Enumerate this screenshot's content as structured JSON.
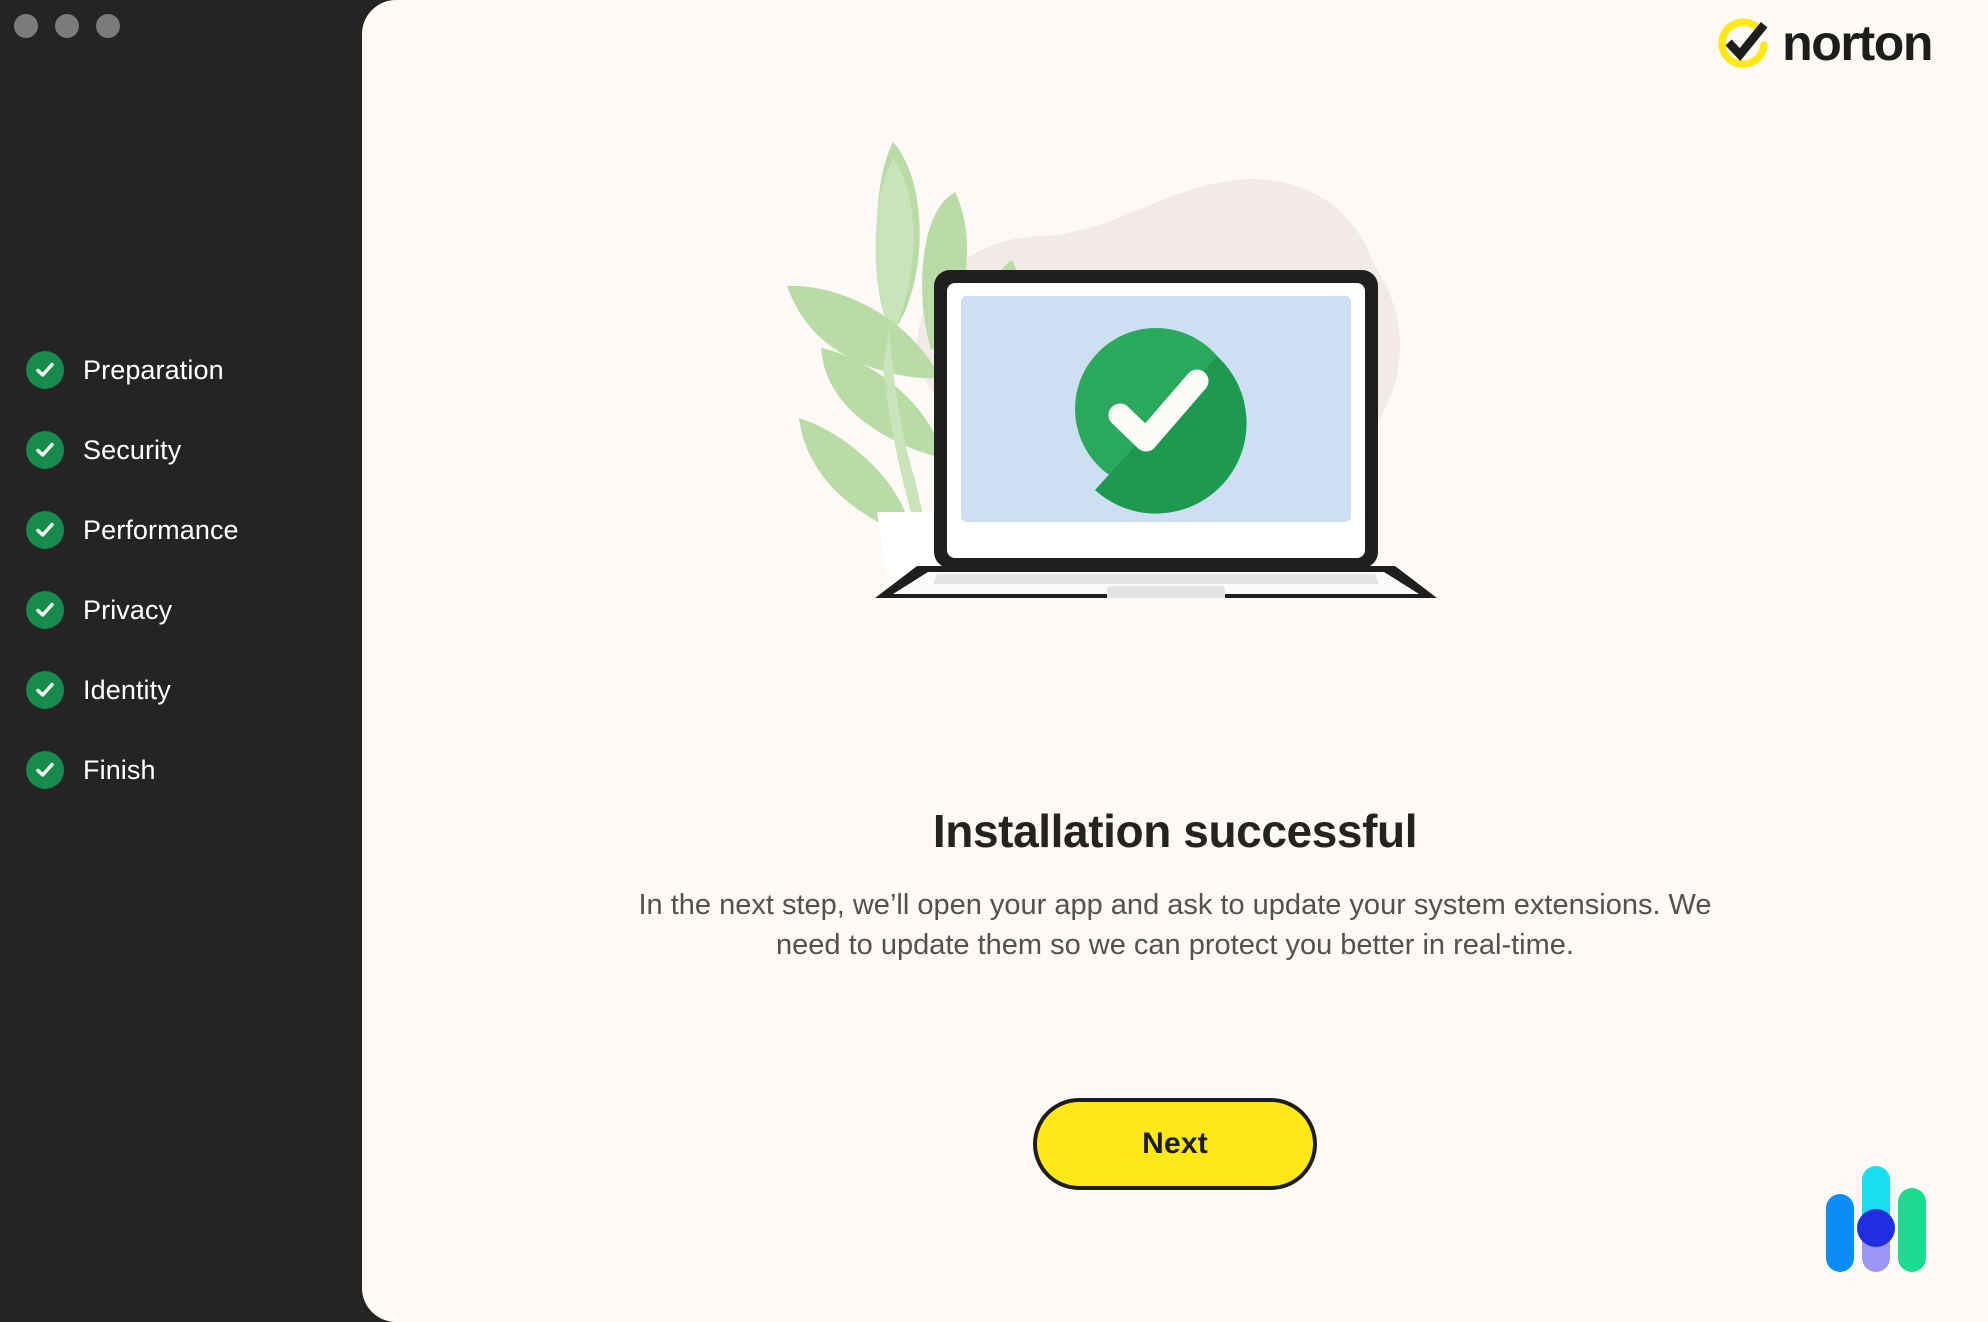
{
  "window": {
    "controls": [
      {
        "name": "close",
        "color": "#7b7b7b"
      },
      {
        "name": "minimize",
        "color": "#7b7b7b"
      },
      {
        "name": "zoom",
        "color": "#7b7b7b"
      }
    ],
    "sidebar_bg": "#242424",
    "panel_bg": "#fdf9f6"
  },
  "sidebar": {
    "items": [
      {
        "label": "Preparation",
        "state": "completed",
        "icon": "check-circle-icon"
      },
      {
        "label": "Security",
        "state": "completed",
        "icon": "check-circle-icon"
      },
      {
        "label": "Performance",
        "state": "completed",
        "icon": "check-circle-icon"
      },
      {
        "label": "Privacy",
        "state": "completed",
        "icon": "check-circle-icon"
      },
      {
        "label": "Identity",
        "state": "completed",
        "icon": "check-circle-icon"
      },
      {
        "label": "Finish",
        "state": "completed",
        "icon": "check-circle-icon"
      }
    ],
    "check_color": "#178b4b"
  },
  "brand": {
    "logo_icon": "norton-check-icon",
    "wordmark": "norton",
    "logo_ring_color": "#ffe817",
    "logo_check_color": "#1d1d1b"
  },
  "illustration": {
    "icon": "laptop-success-illustration",
    "elements": [
      "plant-leaves",
      "plant-pot",
      "beige-blob",
      "laptop",
      "laptop-screen",
      "success-check-circle",
      "coffee-mug",
      "steam"
    ],
    "colors": {
      "leaf": "#b9dba6",
      "blob": "#f2eae6",
      "screen": "#cfdff2",
      "laptop_outline": "#1f1f1f",
      "laptop_body": "#ffffff",
      "success_green": "#2aa85c",
      "success_green_dark": "#1e9a50",
      "mug": "#c89cb0",
      "steam": "#fdfbf8"
    }
  },
  "content": {
    "headline": "Installation successful",
    "body": "In the next step, we’ll open your app and ask to update your system extensions. We need to update them so we can protect you better in real-time."
  },
  "actions": {
    "next_label": "Next",
    "next_bg": "#ffe817",
    "next_border": "#1d1d1b"
  },
  "footer": {
    "logo_icon": "gen-digital-bars-icon",
    "bar_colors": [
      "#0b8df6",
      "#19dff0",
      "#9b96f7",
      "#1f2fe0",
      "#1ddb8f"
    ]
  }
}
